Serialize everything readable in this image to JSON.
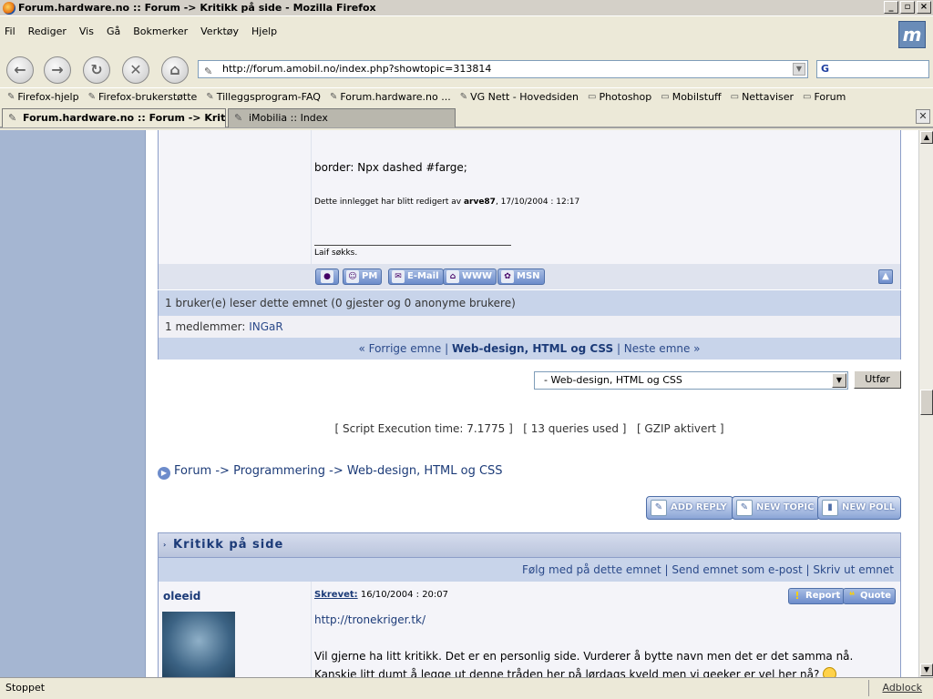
{
  "window": {
    "title": "Forum.hardware.no :: Forum -> Kritikk på side - Mozilla Firefox"
  },
  "menu": [
    "Fil",
    "Rediger",
    "Vis",
    "Gå",
    "Bokmerker",
    "Verktøy",
    "Hjelp"
  ],
  "url": "http://forum.amobil.no/index.php?showtopic=313814",
  "search_engine": "G",
  "bookmarks": [
    "Firefox-hjelp",
    "Firefox-brukerstøtte",
    "Tilleggsprogram-FAQ",
    "Forum.hardware.no ...",
    "VG Nett - Hovedsiden",
    "Photoshop",
    "Mobilstuff",
    "Nettaviser",
    "Forum"
  ],
  "tabs": [
    {
      "label": "Forum.hardware.no :: Forum -> Kritik..."
    },
    {
      "label": "iMobilia :: Index"
    }
  ],
  "post1": {
    "text": "border: Npx dashed #farge;",
    "edit_prefix": "Dette innlegget har blitt redigert av ",
    "edit_user": "arve87",
    "edit_suffix": ", 17/10/2004 : 12:17",
    "signature": "Laif søkks."
  },
  "post_buttons": [
    "PM",
    "E-Mail",
    "WWW",
    "MSN"
  ],
  "info": {
    "readers": "1 bruker(e) leser dette emnet (0 gjester og 0 anonyme brukere)",
    "members_label": "1 medlemmer:",
    "member": "INGaR",
    "prev": "« Forrige emne",
    "forum": "Web-design, HTML og CSS",
    "next": "Neste emne »"
  },
  "jump": {
    "selected": "- Web-design, HTML og CSS",
    "go": "Utfør"
  },
  "exec": {
    "time": "[ Script Execution time: 7.1775 ]",
    "queries": "[ 13 queries used ]",
    "gzip": "[ GZIP aktivert ]"
  },
  "breadcrumb": {
    "a": "Forum",
    "sep": " -> ",
    "b": "Programmering",
    "c": "Web-design, HTML og CSS"
  },
  "actions": {
    "reply": "ADD REPLY",
    "topic": "NEW TOPIC",
    "poll": "NEW POLL"
  },
  "topic": {
    "title": "Kritikk på side",
    "follow": "Følg med på dette emnet",
    "send": "Send emnet som e-post",
    "print": "Skriv ut emnet"
  },
  "post2": {
    "user": "oleeid",
    "posted_label": "Skrevet:",
    "posted_time": " 16/10/2004 : 20:07",
    "report": "Report",
    "quote": "Quote",
    "link": "http://tronekriger.tk/",
    "text": "Vil gjerne ha litt kritikk. Det er en personlig side. Vurderer å bytte navn men det er det samma nå. Kanskje litt dumt å legge ut denne tråden her på lørdags kveld men vi geeker er vel her nå?"
  },
  "status": {
    "left": "Stoppet",
    "right": "Adblock"
  }
}
